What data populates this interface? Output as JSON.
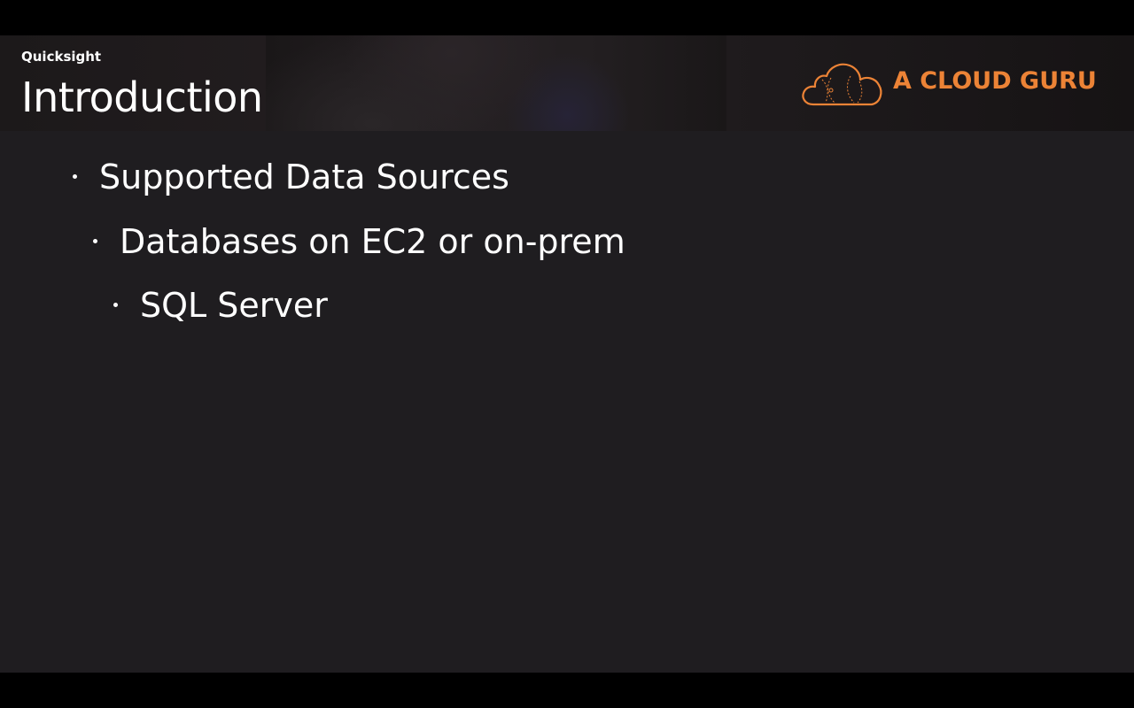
{
  "header": {
    "course": "Quicksight",
    "title": "Introduction"
  },
  "brand": {
    "name": "A CLOUD GURU",
    "logo_icon": "cloud-icon",
    "color": "#ec8336"
  },
  "bullets": [
    {
      "level": 1,
      "text": "Supported Data Sources"
    },
    {
      "level": 2,
      "text": "Databases on EC2 or on-prem"
    },
    {
      "level": 3,
      "text": "SQL Server"
    }
  ],
  "colors": {
    "slide_background": "#1f1d20",
    "letterbox": "#000000",
    "text": "#ffffff"
  }
}
